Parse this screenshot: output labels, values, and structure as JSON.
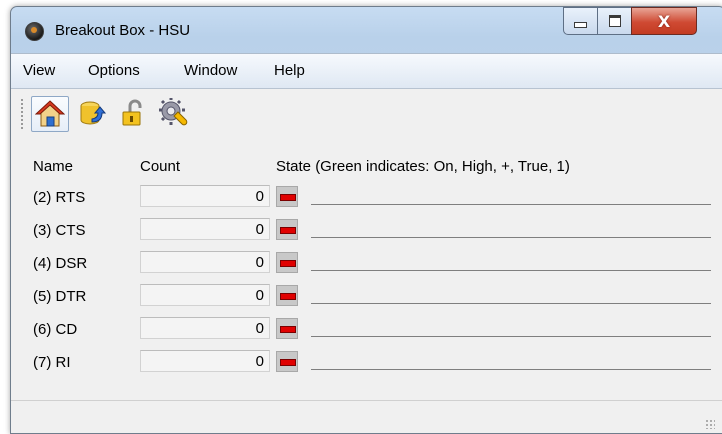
{
  "window": {
    "title": "Breakout Box - HSU"
  },
  "caption_buttons": {
    "close_label": "X"
  },
  "menu": [
    "View",
    "Options",
    "Window",
    "Help"
  ],
  "toolbar": {
    "tools": [
      "home-icon",
      "database-refresh-icon",
      "unlock-icon",
      "settings-wrench-icon"
    ]
  },
  "table": {
    "headers": {
      "name": "Name",
      "count": "Count",
      "state": "State (Green indicates: On, High, +, True, 1)"
    },
    "rows": [
      {
        "name": "(2) RTS",
        "count": "0",
        "state": "off"
      },
      {
        "name": "(3) CTS",
        "count": "0",
        "state": "off"
      },
      {
        "name": "(4) DSR",
        "count": "0",
        "state": "off"
      },
      {
        "name": "(5) DTR",
        "count": "0",
        "state": "off"
      },
      {
        "name": "(6) CD",
        "count": "0",
        "state": "off"
      },
      {
        "name": "(7) RI",
        "count": "0",
        "state": "off"
      }
    ]
  },
  "colors": {
    "led_off": "#e00000",
    "led_on": "#00c000"
  }
}
